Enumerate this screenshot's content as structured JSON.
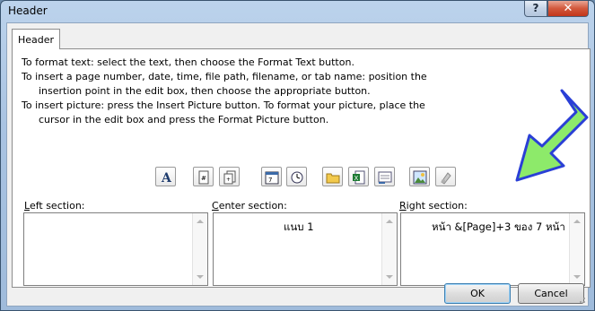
{
  "window": {
    "title": "Header",
    "help_label": "?",
    "close_label": "✕"
  },
  "tab": {
    "label": "Header"
  },
  "instructions": {
    "line1": "To format text:  select the text, then choose the Format Text button.",
    "line2": "To insert a page number, date, time, file path, filename, or tab name:  position the",
    "line3": "insertion point in the edit box, then choose the appropriate button.",
    "line4": "To insert picture: press the Insert Picture button.  To format your picture, place the",
    "line5": "cursor in the edit box and press the Format Picture button."
  },
  "toolbar_icons": [
    "format-text-icon",
    "insert-page-number-icon",
    "insert-number-of-pages-icon",
    "insert-date-icon",
    "insert-time-icon",
    "insert-file-path-icon",
    "insert-file-name-icon",
    "insert-sheet-name-icon",
    "insert-picture-icon",
    "format-picture-icon"
  ],
  "sections": {
    "left": {
      "label_accel": "L",
      "label_rest": "eft section:",
      "value": ""
    },
    "center": {
      "label_accel": "C",
      "label_rest": "enter section:",
      "value": "แนบ 1"
    },
    "right": {
      "label_accel": "R",
      "label_rest": "ight section:",
      "value": "หน้า &[Page]+3 ของ 7 หน้า"
    }
  },
  "buttons": {
    "ok": "OK",
    "cancel": "Cancel"
  },
  "annotation": {
    "arrow_color": "#8dea6a",
    "arrow_outline": "#2a3fd6"
  }
}
